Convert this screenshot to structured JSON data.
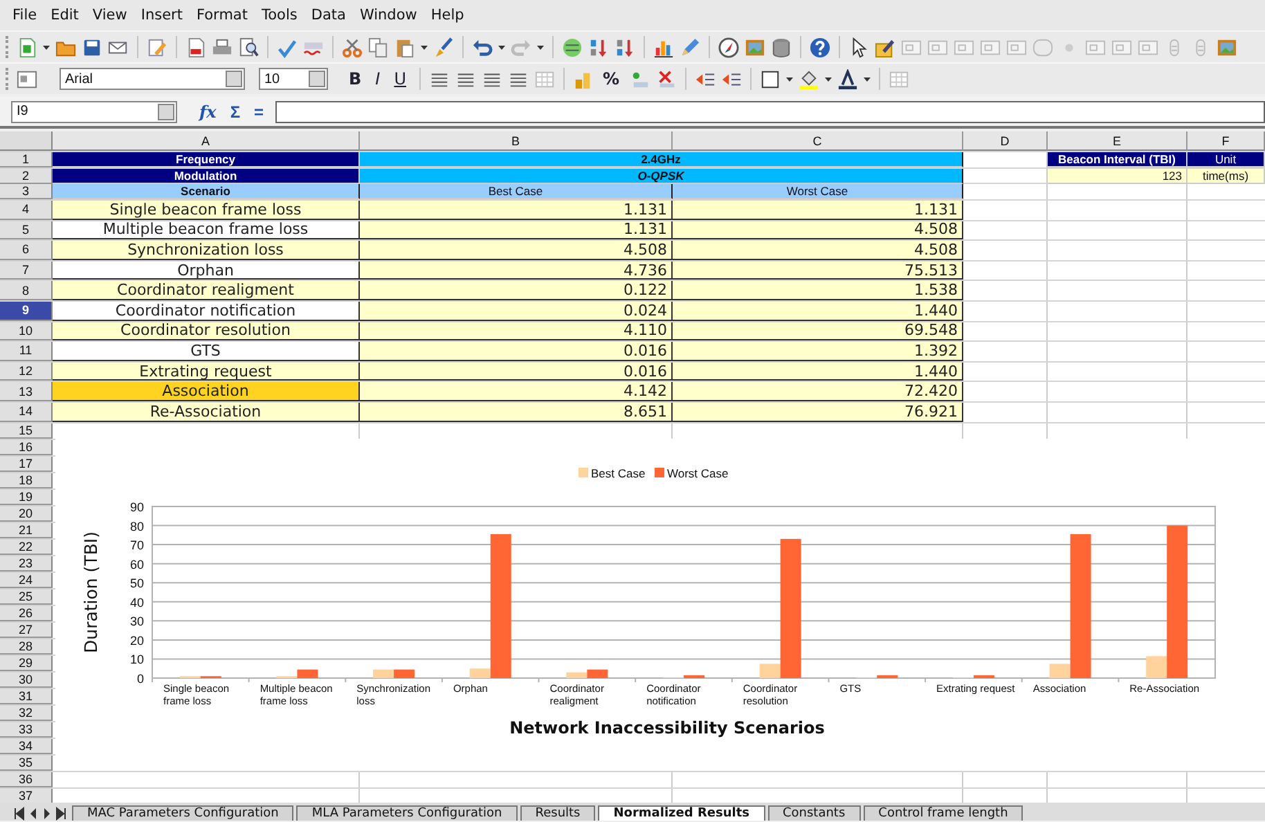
{
  "menu": [
    "File",
    "Edit",
    "View",
    "Insert",
    "Format",
    "Tools",
    "Data",
    "Window",
    "Help"
  ],
  "formatting": {
    "font": "Arial",
    "size": "10",
    "style_buttons": [
      "B",
      "I",
      "U"
    ],
    "percent_button": "%"
  },
  "formula_bar": {
    "cell_ref": "I9",
    "buttons": [
      "fx",
      "Σ",
      "="
    ]
  },
  "columns": [
    "A",
    "B",
    "C",
    "D",
    "E",
    "F"
  ],
  "row_numbers": [
    {
      "label": "1",
      "selected": false
    },
    {
      "label": "2",
      "selected": false
    },
    {
      "label": "3",
      "selected": false
    },
    {
      "label": "4",
      "selected": false
    },
    {
      "label": "5",
      "selected": false
    },
    {
      "label": "6",
      "selected": false
    },
    {
      "label": "7",
      "selected": false
    },
    {
      "label": "8",
      "selected": false
    },
    {
      "label": "9",
      "selected": true
    },
    {
      "label": "10",
      "selected": false
    },
    {
      "label": "11",
      "selected": false
    },
    {
      "label": "12",
      "selected": false
    },
    {
      "label": "13",
      "selected": false
    },
    {
      "label": "14",
      "selected": false
    },
    {
      "label": "15",
      "selected": false
    },
    {
      "label": "16",
      "selected": false
    },
    {
      "label": "17",
      "selected": false
    },
    {
      "label": "18",
      "selected": false
    },
    {
      "label": "19",
      "selected": false
    },
    {
      "label": "20",
      "selected": false
    },
    {
      "label": "21",
      "selected": false
    },
    {
      "label": "22",
      "selected": false
    },
    {
      "label": "23",
      "selected": false
    },
    {
      "label": "24",
      "selected": false
    },
    {
      "label": "25",
      "selected": false
    },
    {
      "label": "26",
      "selected": false
    },
    {
      "label": "27",
      "selected": false
    },
    {
      "label": "28",
      "selected": false
    },
    {
      "label": "29",
      "selected": false
    },
    {
      "label": "30",
      "selected": false
    },
    {
      "label": "31",
      "selected": false
    },
    {
      "label": "32",
      "selected": false
    },
    {
      "label": "33",
      "selected": false
    },
    {
      "label": "34",
      "selected": false
    },
    {
      "label": "35",
      "selected": false
    },
    {
      "label": "36",
      "selected": false
    },
    {
      "label": "37",
      "selected": false
    }
  ],
  "header": {
    "frequency_label": "Frequency",
    "frequency": "2.4GHz",
    "modulation_label": "Modulation",
    "modulation": "O-QPSK",
    "scenario": "Scenario",
    "best": "Best Case",
    "worst": "Worst Case"
  },
  "beacon": {
    "label": "Beacon Interval (TBI)",
    "unit_label": "Unit",
    "value": "123",
    "unit": "time(ms)"
  },
  "scenarios": [
    {
      "name": "Single beacon frame loss",
      "color": "#ffffcc",
      "best": "1.131",
      "worst": "1.131"
    },
    {
      "name": "Multiple beacon frame loss",
      "color": "#ffffff",
      "best": "1.131",
      "worst": "4.508"
    },
    {
      "name": "Synchronization loss",
      "color": "#ffffcc",
      "best": "4.508",
      "worst": "4.508"
    },
    {
      "name": "Orphan",
      "color": "#ffffff",
      "best": "4.736",
      "worst": "75.513"
    },
    {
      "name": "Coordinator realigment",
      "color": "#ffffcc",
      "best": "0.122",
      "worst": "1.538"
    },
    {
      "name": "Coordinator notification",
      "color": "#ffffff",
      "best": "0.024",
      "worst": "1.440"
    },
    {
      "name": "Coordinator resolution",
      "color": "#ffffcc",
      "best": "4.110",
      "worst": "69.548"
    },
    {
      "name": "GTS",
      "color": "#ffffff",
      "best": "0.016",
      "worst": "1.392"
    },
    {
      "name": "Extrating request",
      "color": "#ffffcc",
      "best": "0.016",
      "worst": "1.440"
    },
    {
      "name": "Association",
      "color": "#ffd320",
      "best": "4.142",
      "worst": "72.420"
    },
    {
      "name": "Re-Association",
      "color": "#ffffcc",
      "best": "8.651",
      "worst": "76.921"
    }
  ],
  "chart": {
    "chart_data": {
      "type": "bar",
      "xlabel": "Network Inaccessibility Scenarios",
      "ylabel": "Duration (TBI)",
      "categories": [
        "Single beacon frame loss",
        "Multiple beacon frame loss",
        "Synchronization loss",
        "Orphan",
        "Coordinator realigment",
        "Coordinator notification",
        "Coordinator resolution",
        "GTS",
        "Extrating request",
        "Association",
        "Re-Association"
      ],
      "series": [
        {
          "name": "Best Case",
          "color": "#ffd39b",
          "values": [
            1,
            1,
            4.5,
            5,
            3,
            0.3,
            7.5,
            0.3,
            0.3,
            7.5,
            11.5
          ]
        },
        {
          "name": "Worst Case",
          "color": "#ff6633",
          "values": [
            1,
            4.5,
            4.5,
            75.5,
            4.5,
            1.5,
            73,
            1.5,
            1.5,
            75.5,
            80
          ]
        }
      ],
      "ylim": [
        0,
        90
      ],
      "yticks": [
        0,
        10,
        20,
        30,
        40,
        50,
        60,
        70,
        80,
        90
      ],
      "grid": true,
      "legend": true
    }
  },
  "sheet_tabs": [
    {
      "label": "MAC Parameters Configuration",
      "selected": false
    },
    {
      "label": "MLA Parameters Configuration",
      "selected": false
    },
    {
      "label": "Results",
      "selected": false
    },
    {
      "label": "Normalized Results",
      "selected": true
    },
    {
      "label": "Constants",
      "selected": false
    },
    {
      "label": "Control frame length",
      "selected": false
    }
  ]
}
